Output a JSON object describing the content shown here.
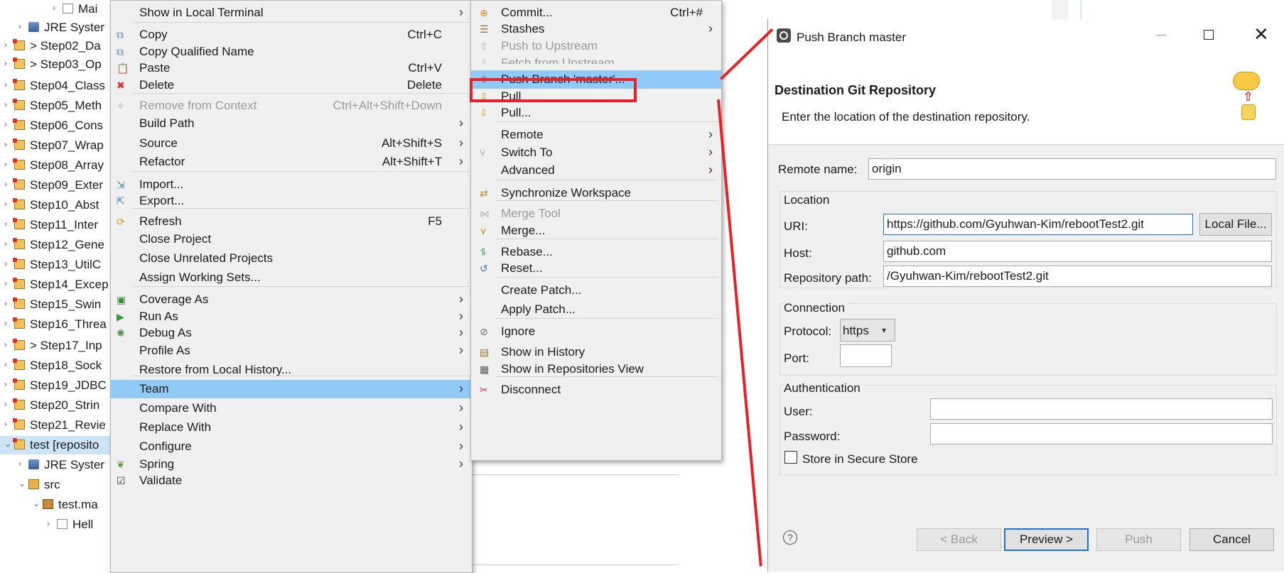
{
  "tree": {
    "items": [
      {
        "label": "Mai",
        "icon": "java-file-icon"
      },
      {
        "label": "JRE Syster",
        "icon": "library-icon"
      },
      {
        "label": "> Step02_Da",
        "icon": "project-icon"
      },
      {
        "label": "> Step03_Op",
        "icon": "project-icon"
      },
      {
        "label": "Step04_Class",
        "icon": "project-icon"
      },
      {
        "label": "Step05_Meth",
        "icon": "project-icon"
      },
      {
        "label": "Step06_Cons",
        "icon": "project-icon"
      },
      {
        "label": "Step07_Wrap",
        "icon": "project-icon"
      },
      {
        "label": "Step08_Array",
        "icon": "project-icon"
      },
      {
        "label": "Step09_Exter",
        "icon": "project-icon"
      },
      {
        "label": "Step10_Abst",
        "icon": "project-icon"
      },
      {
        "label": "Step11_Inter",
        "icon": "project-icon"
      },
      {
        "label": "Step12_Gene",
        "icon": "project-icon"
      },
      {
        "label": "Step13_UtilC",
        "icon": "project-icon"
      },
      {
        "label": "Step14_Excep",
        "icon": "project-icon"
      },
      {
        "label": "Step15_Swin",
        "icon": "project-icon"
      },
      {
        "label": "Step16_Threa",
        "icon": "project-icon"
      },
      {
        "label": "> Step17_Inp",
        "icon": "project-icon"
      },
      {
        "label": "Step18_Sock",
        "icon": "project-icon"
      },
      {
        "label": "Step19_JDBC",
        "icon": "project-icon"
      },
      {
        "label": "Step20_Strin",
        "icon": "project-icon"
      },
      {
        "label": "Step21_Revie",
        "icon": "project-icon"
      },
      {
        "label": "test [reposito",
        "icon": "project-icon"
      },
      {
        "label": "JRE Syster",
        "icon": "library-icon"
      },
      {
        "label": "src",
        "icon": "source-folder-icon"
      },
      {
        "label": "test.ma",
        "icon": "package-icon"
      },
      {
        "label": "Hell",
        "icon": "java-file-icon"
      }
    ]
  },
  "context_menu": {
    "items": [
      {
        "label": "Show in Local Terminal",
        "shortcut": "",
        "submenu": true,
        "disabled": false
      },
      {
        "label": "Copy",
        "shortcut": "Ctrl+C",
        "submenu": false,
        "disabled": false,
        "icon": "copy-icon"
      },
      {
        "label": "Copy Qualified Name",
        "shortcut": "",
        "submenu": false,
        "disabled": false,
        "icon": "copy-qualified-icon"
      },
      {
        "label": "Paste",
        "shortcut": "Ctrl+V",
        "submenu": false,
        "disabled": false,
        "icon": "paste-icon"
      },
      {
        "label": "Delete",
        "shortcut": "Delete",
        "submenu": false,
        "disabled": false,
        "icon": "delete-icon"
      },
      {
        "label": "Remove from Context",
        "shortcut": "Ctrl+Alt+Shift+Down",
        "submenu": false,
        "disabled": true,
        "icon": "remove-context-icon"
      },
      {
        "label": "Build Path",
        "shortcut": "",
        "submenu": true,
        "disabled": false
      },
      {
        "label": "Source",
        "shortcut": "Alt+Shift+S",
        "submenu": true,
        "disabled": false
      },
      {
        "label": "Refactor",
        "shortcut": "Alt+Shift+T",
        "submenu": true,
        "disabled": false
      },
      {
        "label": "Import...",
        "shortcut": "",
        "submenu": false,
        "disabled": false,
        "icon": "import-icon"
      },
      {
        "label": "Export...",
        "shortcut": "",
        "submenu": false,
        "disabled": false,
        "icon": "export-icon"
      },
      {
        "label": "Refresh",
        "shortcut": "F5",
        "submenu": false,
        "disabled": false,
        "icon": "refresh-icon"
      },
      {
        "label": "Close Project",
        "shortcut": "",
        "submenu": false,
        "disabled": false
      },
      {
        "label": "Close Unrelated Projects",
        "shortcut": "",
        "submenu": false,
        "disabled": false
      },
      {
        "label": "Assign Working Sets...",
        "shortcut": "",
        "submenu": false,
        "disabled": false
      },
      {
        "label": "Coverage As",
        "shortcut": "",
        "submenu": true,
        "disabled": false,
        "icon": "coverage-icon"
      },
      {
        "label": "Run As",
        "shortcut": "",
        "submenu": true,
        "disabled": false,
        "icon": "run-icon"
      },
      {
        "label": "Debug As",
        "shortcut": "",
        "submenu": true,
        "disabled": false,
        "icon": "debug-icon"
      },
      {
        "label": "Profile As",
        "shortcut": "",
        "submenu": true,
        "disabled": false
      },
      {
        "label": "Restore from Local History...",
        "shortcut": "",
        "submenu": false,
        "disabled": false
      },
      {
        "label": "Team",
        "shortcut": "",
        "submenu": true,
        "disabled": false,
        "highlighted": true
      },
      {
        "label": "Compare With",
        "shortcut": "",
        "submenu": true,
        "disabled": false
      },
      {
        "label": "Replace With",
        "shortcut": "",
        "submenu": true,
        "disabled": false
      },
      {
        "label": "Configure",
        "shortcut": "",
        "submenu": true,
        "disabled": false
      },
      {
        "label": "Spring",
        "shortcut": "",
        "submenu": true,
        "disabled": false,
        "icon": "spring-icon"
      },
      {
        "label": "Validate",
        "shortcut": "",
        "submenu": false,
        "disabled": false,
        "icon": "validate-checkbox-icon"
      }
    ]
  },
  "team_menu": {
    "items": [
      {
        "label": "Commit...",
        "shortcut": "Ctrl+#",
        "submenu": false,
        "disabled": false,
        "icon": "commit-icon"
      },
      {
        "label": "Stashes",
        "shortcut": "",
        "submenu": true,
        "disabled": false,
        "icon": "stash-icon"
      },
      {
        "label": "Push to Upstream",
        "shortcut": "",
        "submenu": false,
        "disabled": true,
        "icon": "push-upstream-icon"
      },
      {
        "label": "Fetch from Upstream",
        "shortcut": "",
        "submenu": false,
        "disabled": true,
        "icon": "fetch-upstream-icon"
      },
      {
        "label": "Push Branch 'master'...",
        "shortcut": "",
        "submenu": false,
        "disabled": false,
        "highlighted": true,
        "icon": "push-branch-icon"
      },
      {
        "label": "Pull",
        "shortcut": "",
        "submenu": false,
        "disabled": false,
        "icon": "pull-icon"
      },
      {
        "label": "Pull...",
        "shortcut": "",
        "submenu": false,
        "disabled": false,
        "icon": "pull-dialog-icon"
      },
      {
        "label": "Remote",
        "shortcut": "",
        "submenu": true,
        "disabled": false
      },
      {
        "label": "Switch To",
        "shortcut": "",
        "submenu": true,
        "disabled": false,
        "icon": "switch-branch-icon"
      },
      {
        "label": "Advanced",
        "shortcut": "",
        "submenu": true,
        "disabled": false
      },
      {
        "label": "Synchronize Workspace",
        "shortcut": "",
        "submenu": false,
        "disabled": false,
        "icon": "synchronize-icon"
      },
      {
        "label": "Merge Tool",
        "shortcut": "",
        "submenu": false,
        "disabled": true,
        "icon": "merge-tool-icon"
      },
      {
        "label": "Merge...",
        "shortcut": "",
        "submenu": false,
        "disabled": false,
        "icon": "merge-icon"
      },
      {
        "label": "Rebase...",
        "shortcut": "",
        "submenu": false,
        "disabled": false,
        "icon": "rebase-icon"
      },
      {
        "label": "Reset...",
        "shortcut": "",
        "submenu": false,
        "disabled": false,
        "icon": "reset-icon"
      },
      {
        "label": "Create Patch...",
        "shortcut": "",
        "submenu": false,
        "disabled": false
      },
      {
        "label": "Apply Patch...",
        "shortcut": "",
        "submenu": false,
        "disabled": false
      },
      {
        "label": "Ignore",
        "shortcut": "",
        "submenu": false,
        "disabled": false,
        "icon": "ignore-icon"
      },
      {
        "label": "Show in History",
        "shortcut": "",
        "submenu": false,
        "disabled": false,
        "icon": "history-icon"
      },
      {
        "label": "Show in Repositories View",
        "shortcut": "",
        "submenu": false,
        "disabled": false,
        "icon": "repositories-view-icon"
      },
      {
        "label": "Disconnect",
        "shortcut": "",
        "submenu": false,
        "disabled": false,
        "icon": "disconnect-icon"
      }
    ]
  },
  "dialog": {
    "title": "Push Branch master",
    "header_title": "Destination Git Repository",
    "header_desc": "Enter the location of the destination repository.",
    "remote_name_label": "Remote name:",
    "remote_name_value": "origin",
    "location_group": "Location",
    "uri_label": "URI:",
    "uri_value": "https://github.com/Gyuhwan-Kim/rebootTest2.git",
    "local_file_button": "Local File...",
    "host_label": "Host:",
    "host_value": "github.com",
    "repo_path_label": "Repository path:",
    "repo_path_value": "/Gyuhwan-Kim/rebootTest2.git",
    "connection_group": "Connection",
    "protocol_label": "Protocol:",
    "protocol_value": "https",
    "port_label": "Port:",
    "port_value": "",
    "auth_group": "Authentication",
    "user_label": "User:",
    "user_value": "",
    "password_label": "Password:",
    "password_value": "",
    "store_label": "Store in Secure Store",
    "store_checked": false,
    "back_button": "< Back",
    "preview_button": "Preview >",
    "push_button": "Push",
    "cancel_button": "Cancel"
  },
  "colors": {
    "menu_highlight": "#91c9f7",
    "annotation_red": "#e5222a",
    "focus_blue": "#1e6fd0"
  }
}
